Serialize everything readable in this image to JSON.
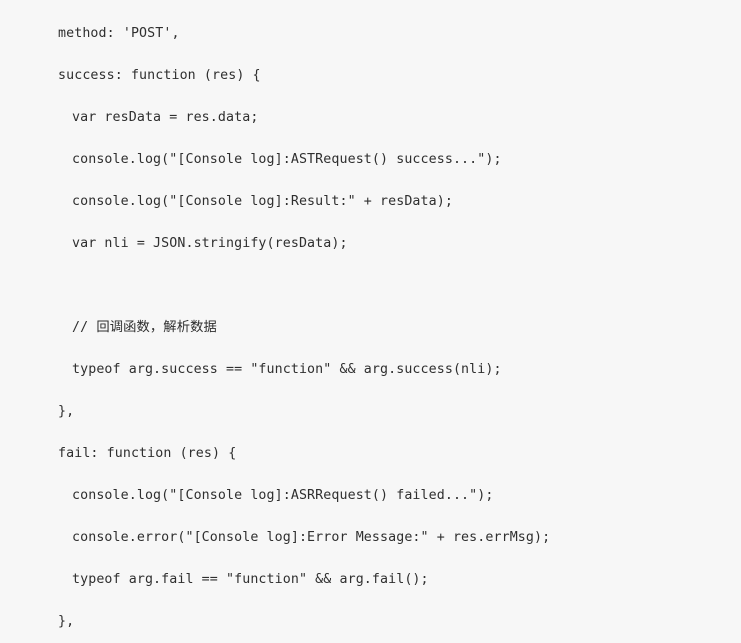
{
  "editor": {
    "background_color": "#f7f7f7",
    "text_color": "#2f2f2f",
    "language": "javascript",
    "lines": [
      {
        "text": "method: 'POST',",
        "indent": 0
      },
      {
        "text": "success: function (res) {",
        "indent": 0
      },
      {
        "text": "var resData = res.data;",
        "indent": 1
      },
      {
        "text": "console.log(\"[Console log]:ASTRequest() success...\");",
        "indent": 1
      },
      {
        "text": "console.log(\"[Console log]:Result:\" + resData);",
        "indent": 1
      },
      {
        "text": "var nli = JSON.stringify(resData);",
        "indent": 1
      },
      {
        "text": "",
        "indent": 0
      },
      {
        "text": "// 回调函数，解析数据",
        "indent": 1
      },
      {
        "text": "typeof arg.success == \"function\" && arg.success(nli);",
        "indent": 1
      },
      {
        "text": "},",
        "indent": 0
      },
      {
        "text": "fail: function (res) {",
        "indent": 0
      },
      {
        "text": "console.log(\"[Console log]:ASRRequest() failed...\");",
        "indent": 1
      },
      {
        "text": "console.error(\"[Console log]:Error Message:\" + res.errMsg);",
        "indent": 1
      },
      {
        "text": "typeof arg.fail == \"function\" && arg.fail();",
        "indent": 1
      },
      {
        "text": "},",
        "indent": 0
      }
    ]
  }
}
